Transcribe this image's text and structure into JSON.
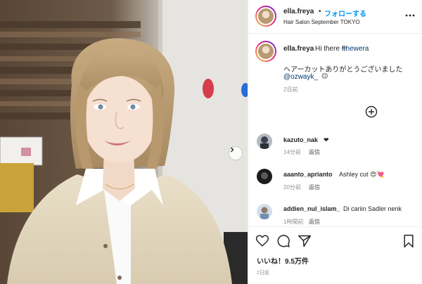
{
  "header": {
    "username": "ella.freya",
    "separator": "•",
    "follow_label": "フォローする",
    "location": "Hair Salon September TOKYO"
  },
  "caption": {
    "username": "ella.freya",
    "text": "Hi there !!!",
    "hashtag": "#newera",
    "line2": "ヘアーカットありがとうございました",
    "mention": "@ozwayk_",
    "emoji": "😉",
    "time": "2日前"
  },
  "comments": [
    {
      "username": "kazuto_nak",
      "text": "❤",
      "time": "14分前",
      "reply_label": "返信"
    },
    {
      "username": "aaanto_aprianto",
      "text": "Ashley cut 😍💘",
      "time": "20分前",
      "reply_label": "返信"
    },
    {
      "username": "addien_nul_islam_",
      "text": "Di cariin Sadler nenk",
      "time": "1時間前",
      "reply_label": "返信"
    }
  ],
  "footer": {
    "likes": "いいね！9.5万件",
    "age": "2日前"
  },
  "icons": {
    "more": "more-options-icon",
    "add": "add-circle-icon",
    "like": "heart-icon",
    "comment": "comment-icon",
    "share": "send-icon",
    "save": "bookmark-icon",
    "next": "chevron-right-icon"
  },
  "colors": {
    "accent": "#0095f6",
    "link": "#00376b",
    "muted": "#8e8e8e",
    "text": "#262626"
  }
}
